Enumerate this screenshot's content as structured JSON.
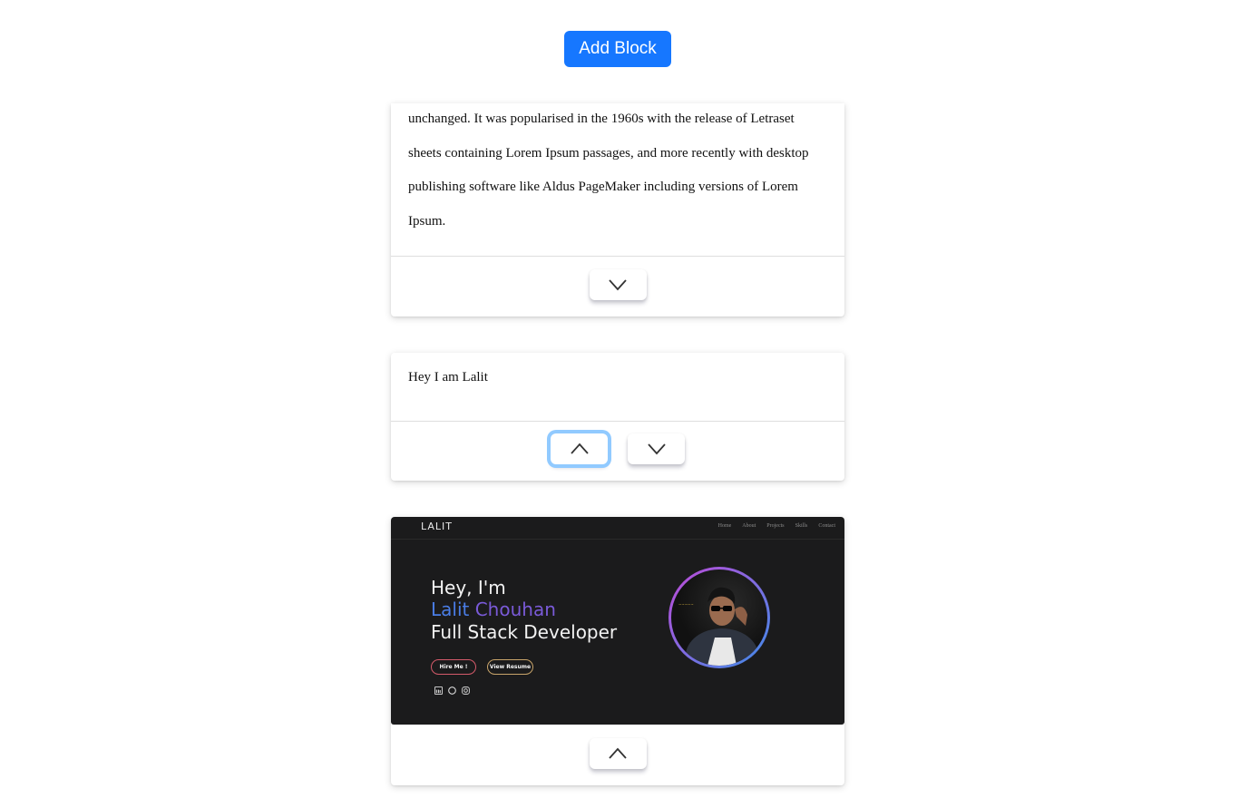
{
  "toolbar": {
    "add_block_label": "Add Block"
  },
  "blocks": [
    {
      "type": "text",
      "lines": [
        "unchanged. It was popularised in the 1960s with the release of Letraset",
        "sheets containing Lorem Ipsum passages, and more recently with desktop",
        "publishing software like Aldus PageMaker including versions of Lorem",
        "Ipsum."
      ],
      "controls": [
        "move-down"
      ]
    },
    {
      "type": "text",
      "text": "Hey I am Lalit",
      "controls": [
        "move-up",
        "move-down"
      ]
    },
    {
      "type": "image",
      "preview": {
        "logo": "LALIT",
        "nav": [
          "Home",
          "About",
          "Projects",
          "Skills",
          "Contact"
        ],
        "greeting": "Hey, I'm",
        "name_first": "Lalit",
        "name_last": "Chouhan",
        "role": "Full Stack Developer",
        "buttons": [
          "Hire Me !",
          "View Resume"
        ],
        "socials": [
          "linkedin-icon",
          "github-icon",
          "instagram-icon"
        ]
      },
      "controls": [
        "move-up"
      ]
    }
  ],
  "colors": {
    "accent": "#1677ff",
    "focus_ring": "#91caff",
    "preview_bg": "#1b1b1c"
  }
}
